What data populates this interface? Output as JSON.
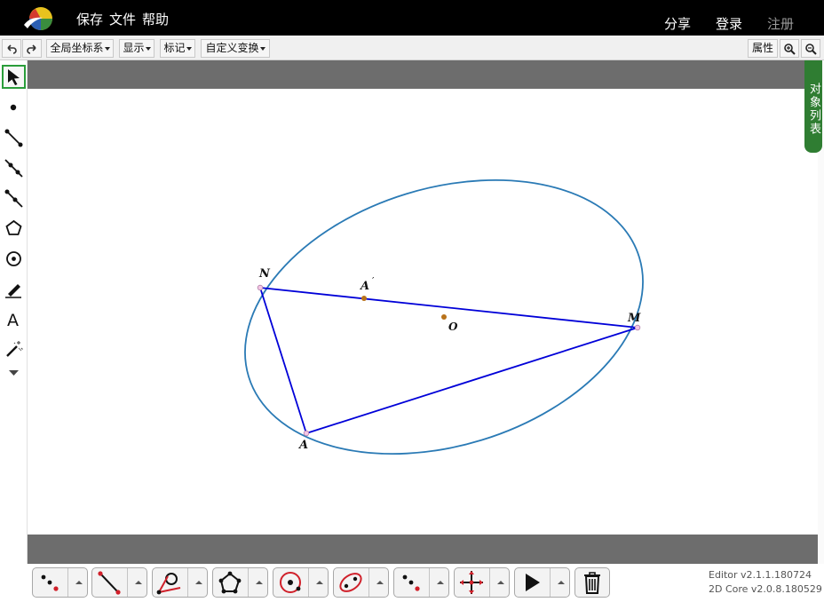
{
  "menu": {
    "save": "保存",
    "file": "文件",
    "help": "帮助"
  },
  "account": {
    "share": "分享",
    "login": "登录",
    "register": "注册"
  },
  "toolbar": {
    "global_coords": "全局坐标系",
    "display": "显示",
    "mark": "标记",
    "custom_transform": "自定义变换",
    "properties": "属性"
  },
  "side_tab": {
    "object_list": "对象列表"
  },
  "labels": {
    "N": "N",
    "A_prime": "A",
    "prime_mark": "′",
    "O": "O",
    "M": "M",
    "A": "A"
  },
  "version": {
    "editor": "Editor v2.1.1.180724",
    "core": "2D Core v2.0.8.180529"
  },
  "colors": {
    "ellipse": "#2a7ab5",
    "triangle": "#0000d8",
    "point_accent": "#b8721a",
    "object_list_tab": "#2f7d32"
  }
}
